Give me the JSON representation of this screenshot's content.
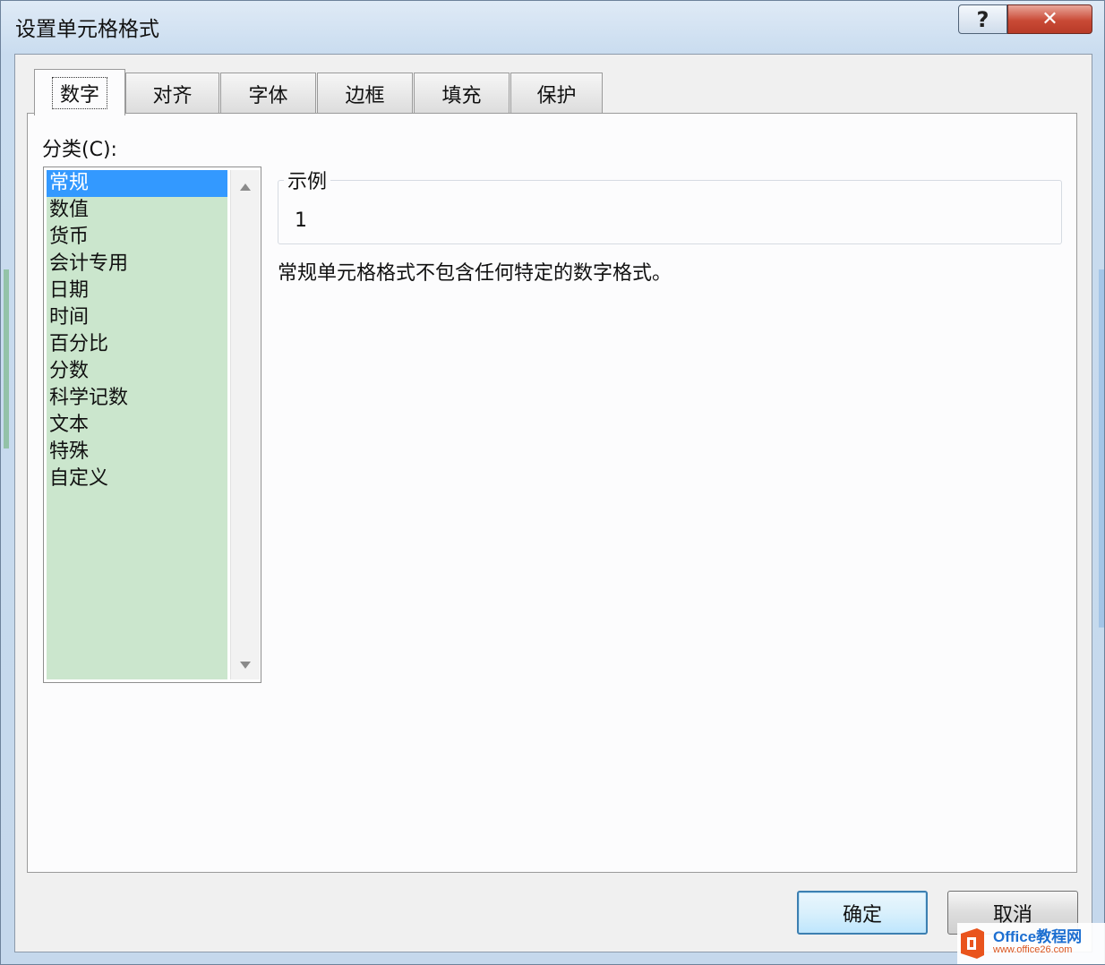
{
  "window": {
    "title": "设置单元格格式",
    "help_glyph": "?",
    "close_glyph": "✕"
  },
  "tabs": [
    {
      "label": "数字",
      "active": true
    },
    {
      "label": "对齐"
    },
    {
      "label": "字体"
    },
    {
      "label": "边框"
    },
    {
      "label": "填充"
    },
    {
      "label": "保护"
    }
  ],
  "category": {
    "label": "分类(C):",
    "items": [
      "常规",
      "数值",
      "货币",
      "会计专用",
      "日期",
      "时间",
      "百分比",
      "分数",
      "科学记数",
      "文本",
      "特殊",
      "自定义"
    ],
    "selected": "常规"
  },
  "sample": {
    "legend": "示例",
    "value": "1"
  },
  "description": "常规单元格格式不包含任何特定的数字格式。",
  "buttons": {
    "ok": "确定",
    "cancel": "取消"
  },
  "watermark": {
    "brand": "Office教程网",
    "url": "www.office26.com"
  },
  "colors": {
    "list_background": "#cbe6cd",
    "selection": "#3399ff",
    "close_button": "#c94a36"
  }
}
